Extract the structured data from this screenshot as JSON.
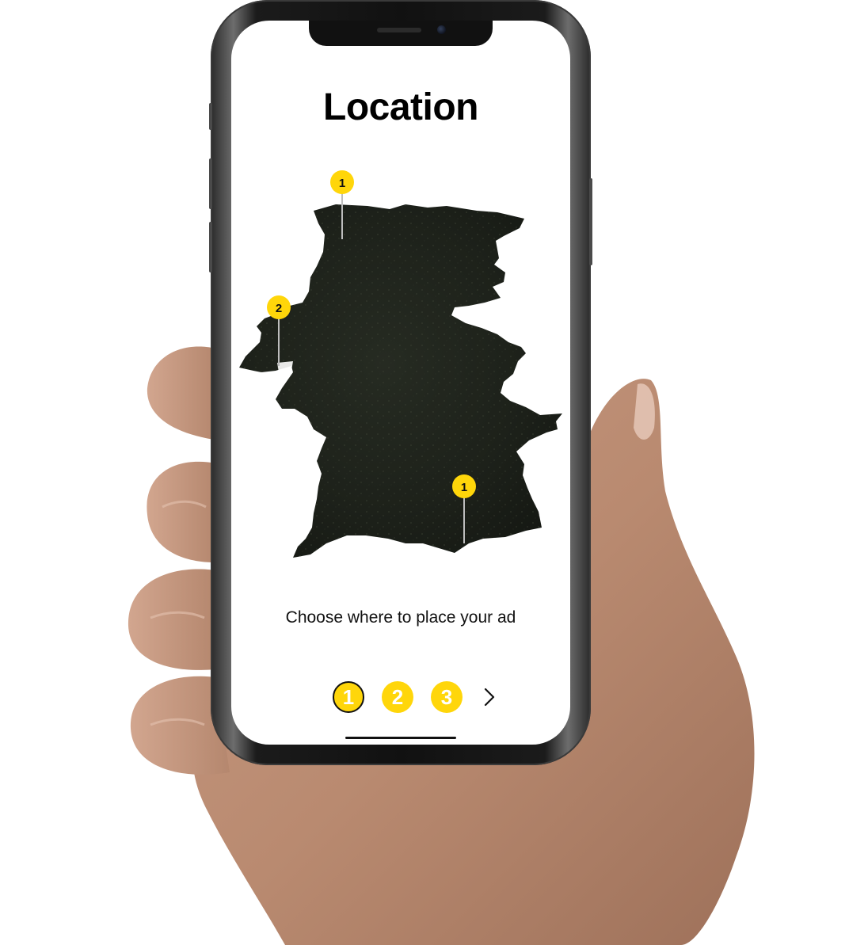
{
  "screen": {
    "title": "Location",
    "subtitle": "Choose where to place your ad"
  },
  "map": {
    "pins": [
      {
        "label": "1"
      },
      {
        "label": "2"
      },
      {
        "label": "1"
      }
    ]
  },
  "steps": {
    "items": [
      "1",
      "2",
      "3"
    ],
    "active_index": 0,
    "next_icon": "chevron-right-icon"
  },
  "colors": {
    "accent": "#ffd60a",
    "map_land": "#1f241d",
    "text": "#000000",
    "background": "#ffffff"
  }
}
